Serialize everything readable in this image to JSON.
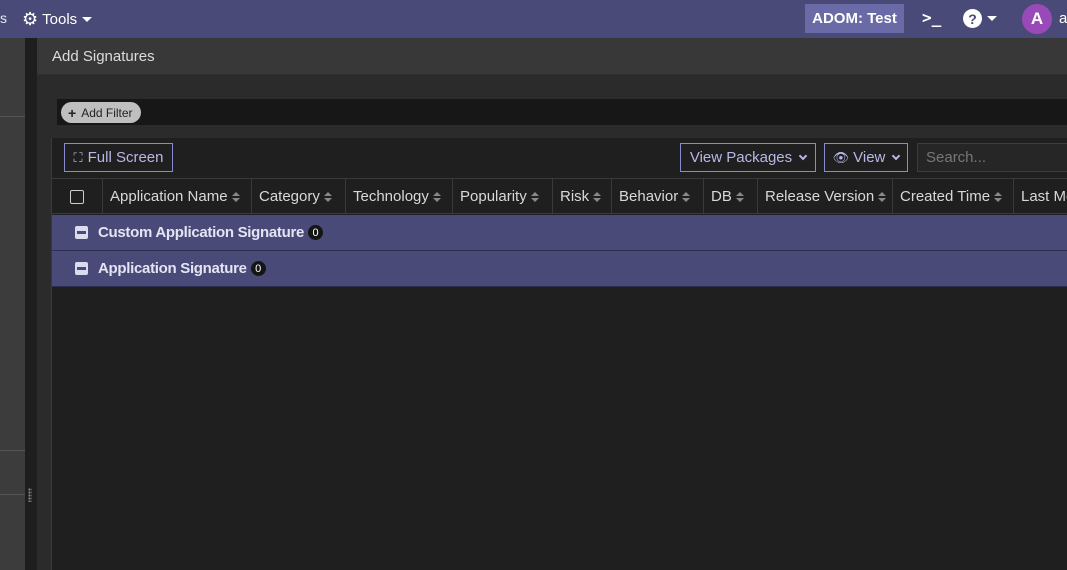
{
  "topbar": {
    "left_fragment": "s",
    "tools_label": "Tools",
    "adom_label": "ADOM: Test",
    "terminal_symbol": ">_",
    "help_symbol": "?",
    "avatar_letter": "A",
    "user_fragment": "a"
  },
  "dialog": {
    "title": "Add Signatures",
    "add_filter_label": "Add Filter"
  },
  "toolbar": {
    "full_screen_label": "Full Screen",
    "view_packages_label": "View Packages",
    "view_label": "View",
    "search_placeholder": "Search..."
  },
  "table": {
    "columns": [
      "Application Name",
      "Category",
      "Technology",
      "Popularity",
      "Risk",
      "Behavior",
      "DB",
      "Release Version",
      "Created Time",
      "Last Mo"
    ],
    "groups": [
      {
        "name": "Custom Application Signature",
        "count": "0"
      },
      {
        "name": "Application Signature",
        "count": "0"
      }
    ]
  },
  "colors": {
    "topbar": "#4a4a78",
    "accent_border": "#8a8ad0",
    "group_row": "#4a4a78",
    "avatar": "#9a4ab8"
  }
}
